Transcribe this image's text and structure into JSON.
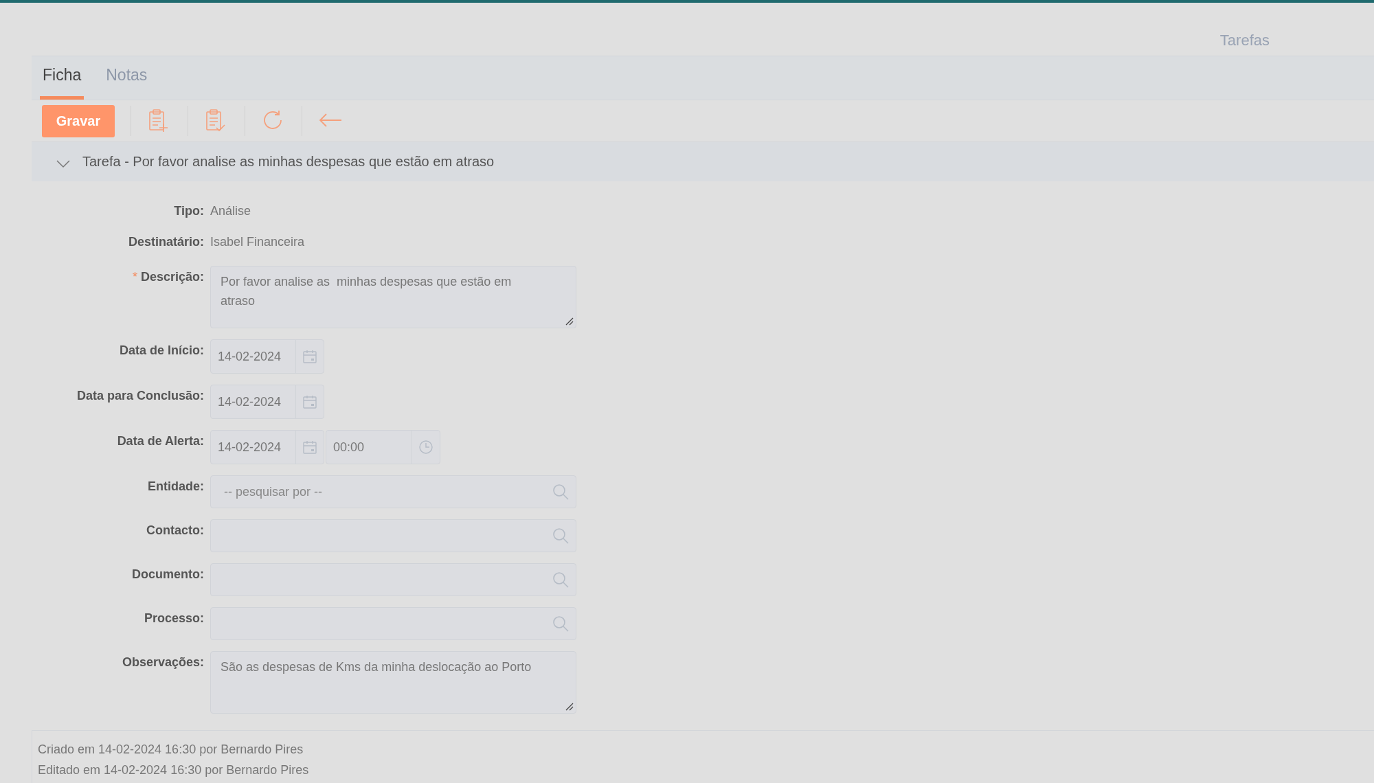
{
  "header": {
    "title": "Tarefas"
  },
  "tabs": [
    {
      "label": "Ficha",
      "selected": true
    },
    {
      "label": "Notas",
      "selected": false
    }
  ],
  "toolbar": [
    {
      "kind": "button",
      "label": "Gravar"
    },
    {
      "kind": "clipboard-plus"
    },
    {
      "kind": "clipboard-check"
    },
    {
      "kind": "refresh"
    },
    {
      "kind": "back"
    }
  ],
  "section": {
    "title": "Tarefa - Por favor analise as minhas despesas que estão em atraso",
    "expanded": true
  },
  "fields": [
    {
      "kind": "text",
      "label": "Tipo:",
      "value": "Análise"
    },
    {
      "kind": "text",
      "label": "Destinatário:",
      "value": "Isabel Financeira"
    },
    {
      "kind": "textarea",
      "label": "Descrição:",
      "required_mark": "*",
      "value": "Por favor analise as  minhas despesas que estão em atraso"
    },
    {
      "kind": "date",
      "label": "Data de Início:",
      "value": "14-02-2024"
    },
    {
      "kind": "date",
      "label": "Data para Conclusão:",
      "value": "14-02-2024"
    },
    {
      "kind": "datetime",
      "label": "Data de Alerta:",
      "value": "14-02-2024",
      "time": "00:00"
    },
    {
      "kind": "lookup",
      "label": "Entidade:",
      "placeholder": "-- pesquisar por --"
    },
    {
      "kind": "lookup",
      "label": "Contacto:"
    },
    {
      "kind": "lookup",
      "label": "Documento:"
    },
    {
      "kind": "lookup",
      "label": "Processo:"
    },
    {
      "kind": "textarea",
      "label": "Observações:",
      "value": "São as despesas de Kms da minha deslocação ao Porto"
    }
  ],
  "footer": {
    "lines": [
      "Criado em 14-02-2024 16:30 por Bernardo Pires",
      "Editado em 14-02-2024 16:30 por Bernardo Pires"
    ]
  }
}
